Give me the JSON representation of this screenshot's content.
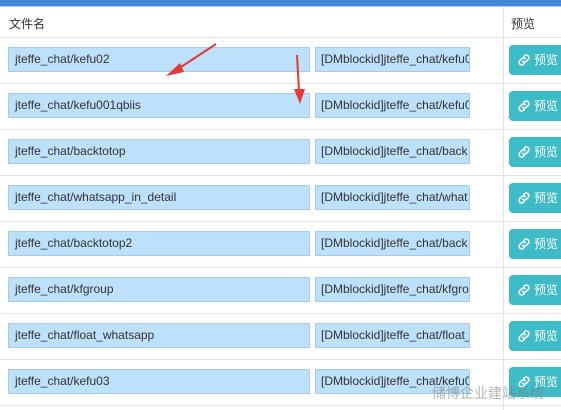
{
  "table": {
    "headers": {
      "name": "文件名",
      "preview": "预览"
    },
    "rows": [
      {
        "name": "jteffe_chat/kefu02",
        "code": "[DMblockid]jteffe_chat/kefu0",
        "preview_label": "预览"
      },
      {
        "name": "jteffe_chat/kefu001qbiis",
        "code": "[DMblockid]jteffe_chat/kefu0",
        "preview_label": "预览"
      },
      {
        "name": "jteffe_chat/backtotop",
        "code": "[DMblockid]jteffe_chat/back",
        "preview_label": "预览"
      },
      {
        "name": "jteffe_chat/whatsapp_in_detail",
        "code": "[DMblockid]jteffe_chat/what",
        "preview_label": "预览"
      },
      {
        "name": "jteffe_chat/backtotop2",
        "code": "[DMblockid]jteffe_chat/back",
        "preview_label": "预览"
      },
      {
        "name": "jteffe_chat/kfgroup",
        "code": "[DMblockid]jteffe_chat/kfgro",
        "preview_label": "预览"
      },
      {
        "name": "jteffe_chat/float_whatsapp",
        "code": "[DMblockid]jteffe_chat/float_",
        "preview_label": "预览"
      },
      {
        "name": "jteffe_chat/kefu03",
        "code": "[DMblockid]jteffe_chat/kefu0",
        "preview_label": "预览"
      }
    ]
  },
  "annotations": {
    "arrow_color": "#e53935"
  },
  "colors": {
    "field_bg": "#bde0fb",
    "button_bg": "#3dbcc8",
    "top_bar": "#3f88d8"
  },
  "icons": {
    "preview_button_icon": "link-icon"
  },
  "watermark": {
    "text": "储博企业建站系统"
  }
}
